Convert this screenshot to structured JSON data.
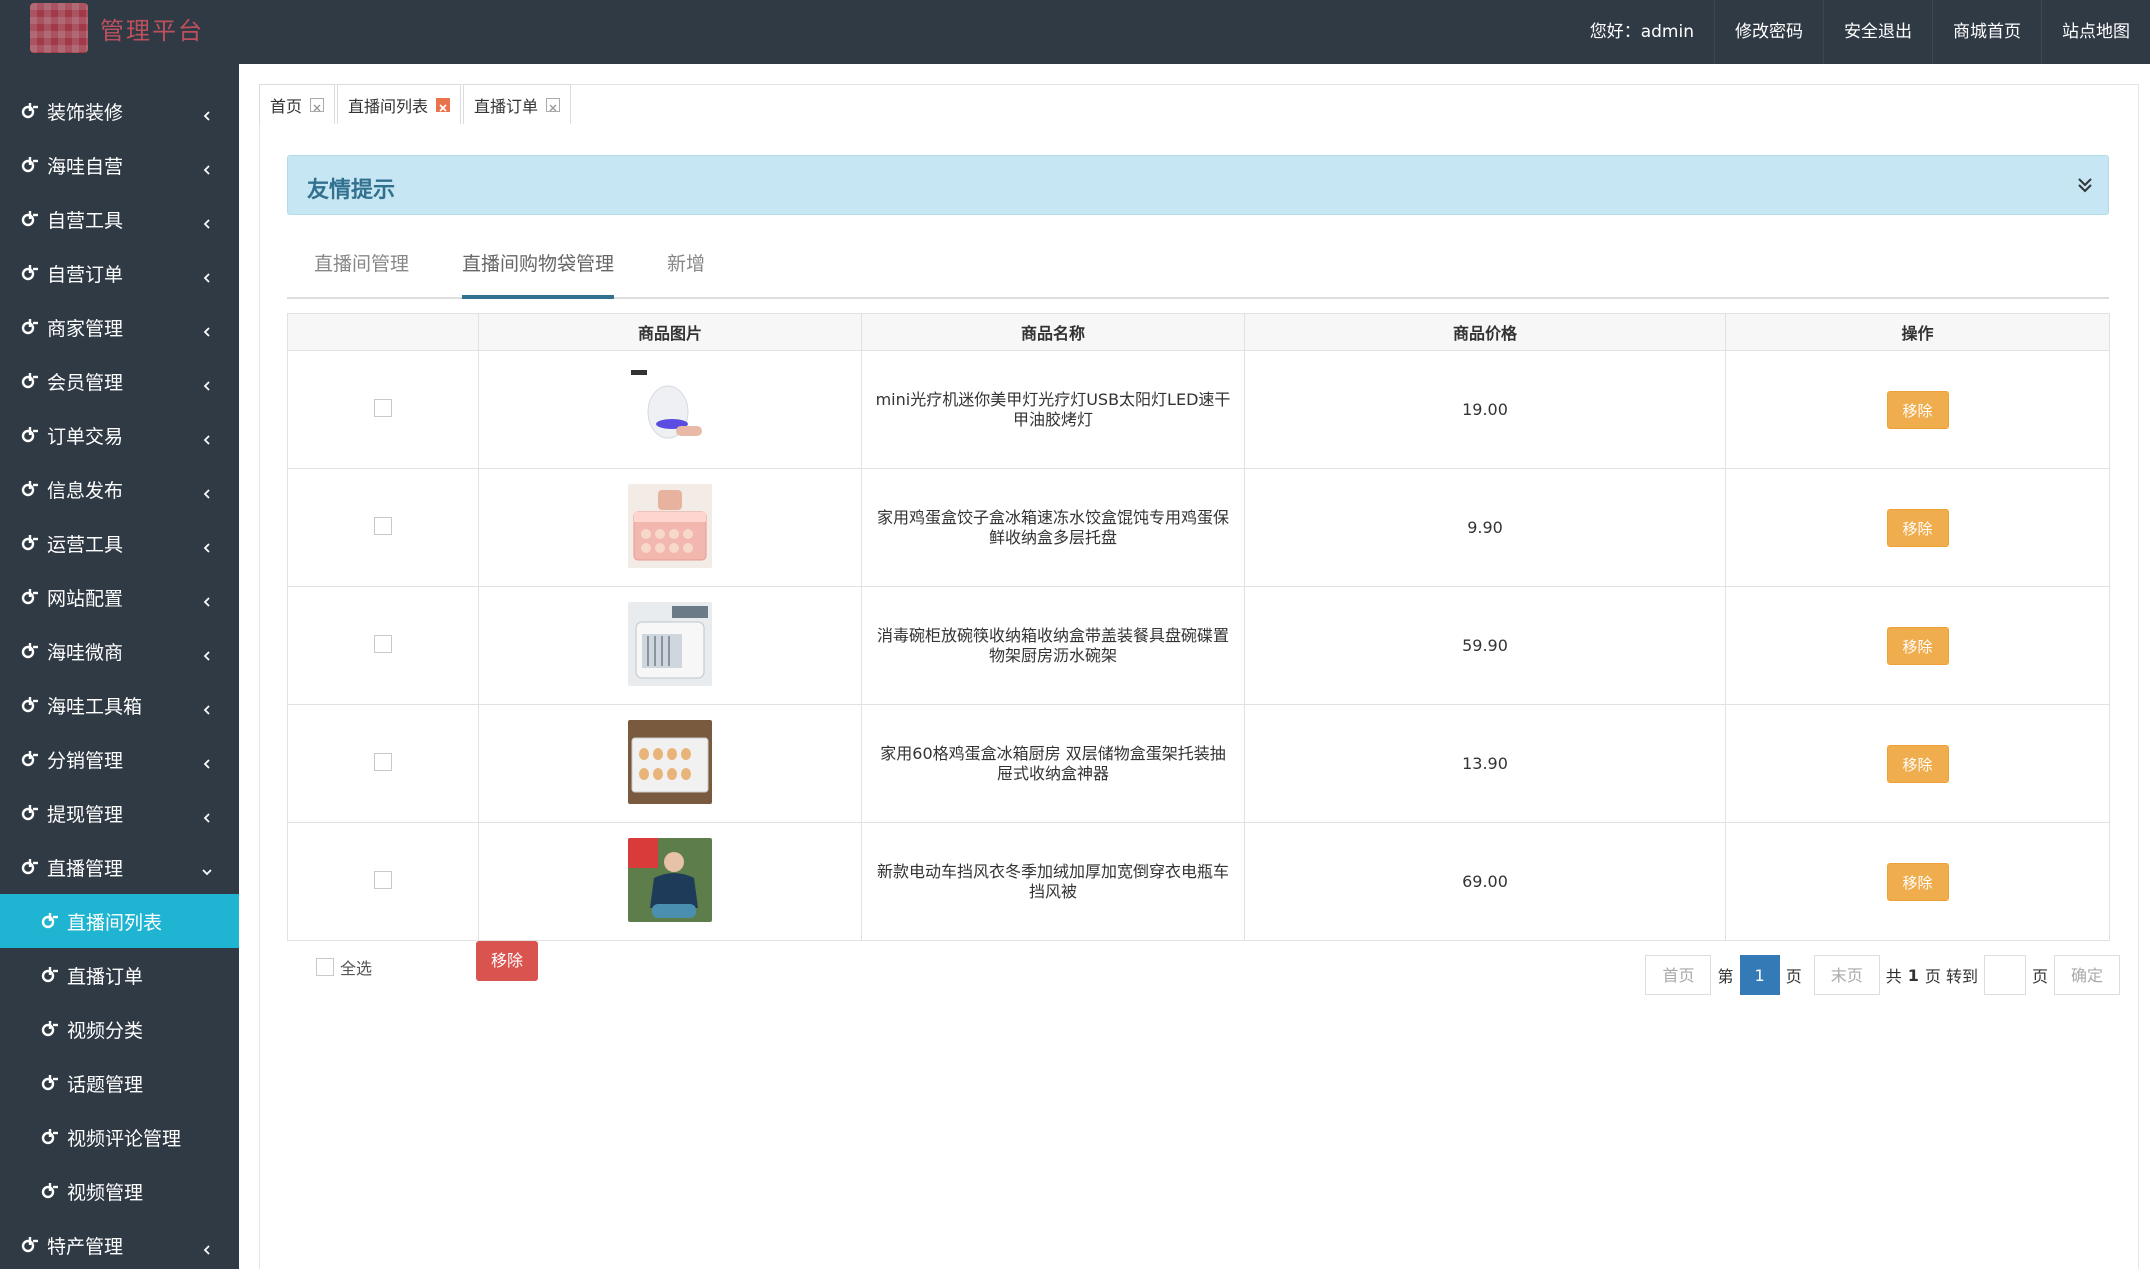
{
  "header": {
    "logo_text": "管理平台",
    "welcome": "您好：admin",
    "nav": [
      "修改密码",
      "安全退出",
      "商城首页",
      "站点地图"
    ]
  },
  "sidebar": {
    "items": [
      {
        "label": "装饰装修",
        "expanded": false
      },
      {
        "label": "海哇自营",
        "expanded": false
      },
      {
        "label": "自营工具",
        "expanded": false
      },
      {
        "label": "自营订单",
        "expanded": false
      },
      {
        "label": "商家管理",
        "expanded": false
      },
      {
        "label": "会员管理",
        "expanded": false
      },
      {
        "label": "订单交易",
        "expanded": false
      },
      {
        "label": "信息发布",
        "expanded": false
      },
      {
        "label": "运营工具",
        "expanded": false
      },
      {
        "label": "网站配置",
        "expanded": false
      },
      {
        "label": "海哇微商",
        "expanded": false
      },
      {
        "label": "海哇工具箱",
        "expanded": false
      },
      {
        "label": "分销管理",
        "expanded": false
      },
      {
        "label": "提现管理",
        "expanded": false
      },
      {
        "label": "直播管理",
        "expanded": true
      }
    ],
    "sub_items": [
      "直播间列表",
      "直播订单",
      "视频分类",
      "话题管理",
      "视频评论管理",
      "视频管理"
    ],
    "after_items": [
      {
        "label": "特产管理",
        "expanded": false
      }
    ],
    "active": "直播间列表"
  },
  "tabs": [
    {
      "label": "首页",
      "active": false
    },
    {
      "label": "直播间列表",
      "active": true
    },
    {
      "label": "直播订单",
      "active": false
    }
  ],
  "alert": {
    "title": "友情提示"
  },
  "subtabs": [
    {
      "label": "直播间管理",
      "active": false
    },
    {
      "label": "直播间购物袋管理",
      "active": true
    },
    {
      "label": "新增",
      "active": false
    }
  ],
  "table": {
    "headers": [
      "",
      "商品图片",
      "商品名称",
      "商品价格",
      "操作"
    ],
    "rows": [
      {
        "name": "mini光疗机迷你美甲灯光疗灯USB太阳灯LED速干甲油胶烤灯",
        "price": "19.00",
        "action": "移除"
      },
      {
        "name": "家用鸡蛋盒饺子盒冰箱速冻水饺盒馄饨专用鸡蛋保鲜收纳盒多层托盘",
        "price": "9.90",
        "action": "移除"
      },
      {
        "name": "消毒碗柜放碗筷收纳箱收纳盒带盖装餐具盘碗碟置物架厨房沥水碗架",
        "price": "59.90",
        "action": "移除"
      },
      {
        "name": "家用60格鸡蛋盒冰箱厨房 双层储物盒蛋架托装抽屉式收纳盒神器",
        "price": "13.90",
        "action": "移除"
      },
      {
        "name": "新款电动车挡风衣冬季加绒加厚加宽倒穿衣电瓶车挡风被",
        "price": "69.00",
        "action": "移除"
      }
    ]
  },
  "footer": {
    "select_all": "全选",
    "remove": "移除",
    "pager": {
      "first": "首页",
      "di": "第",
      "current": "1",
      "ye": "页",
      "last": "末页",
      "total_pre": "共",
      "total": "1",
      "total_post": "页 转到",
      "ye2": "页",
      "confirm": "确定"
    }
  },
  "colors": {
    "sidebar_bg": "#2f3a44",
    "active_item": "#1fb5d2",
    "alert_bg": "#c6e6f3",
    "remove_btn": "#f0ad4e",
    "delete_btn": "#d9534f",
    "page_current": "#337ab7"
  }
}
